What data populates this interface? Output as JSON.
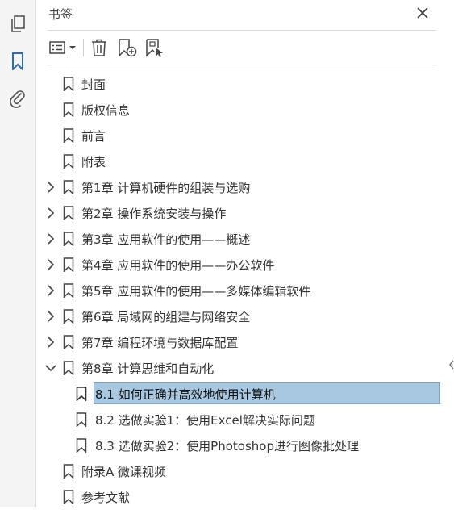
{
  "panel": {
    "title": "书签",
    "close_icon": "close-icon"
  },
  "rail": {
    "icons": [
      "pages-icon",
      "bookmark-icon",
      "attachment-icon"
    ],
    "active": "bookmark-icon",
    "active_color": "#2b6cb0"
  },
  "toolbar": {
    "icons": [
      "options-menu-icon",
      "delete-icon",
      "new-bookmark-icon",
      "bookmark-from-selection-icon"
    ]
  },
  "bookmarks": [
    {
      "label": "封面",
      "level": 0,
      "expandable": false
    },
    {
      "label": "版权信息",
      "level": 0,
      "expandable": false
    },
    {
      "label": "前言",
      "level": 0,
      "expandable": false
    },
    {
      "label": "附表",
      "level": 0,
      "expandable": false
    },
    {
      "label": "第1章 计算机硬件的组装与选购",
      "level": 0,
      "expandable": true,
      "expanded": false
    },
    {
      "label": "第2章 操作系统安装与操作",
      "level": 0,
      "expandable": true,
      "expanded": false
    },
    {
      "label": "第3章 应用软件的使用——概述",
      "level": 0,
      "expandable": true,
      "expanded": false,
      "underlined": true
    },
    {
      "label": "第4章 应用软件的使用——办公软件",
      "level": 0,
      "expandable": true,
      "expanded": false
    },
    {
      "label": "第5章 应用软件的使用——多媒体编辑软件",
      "level": 0,
      "expandable": true,
      "expanded": false
    },
    {
      "label": "第6章 局域网的组建与网络安全",
      "level": 0,
      "expandable": true,
      "expanded": false
    },
    {
      "label": "第7章 编程环境与数据库配置",
      "level": 0,
      "expandable": true,
      "expanded": false
    },
    {
      "label": "第8章 计算思维和自动化",
      "level": 0,
      "expandable": true,
      "expanded": true
    },
    {
      "label": "8.1 如何正确并高效地使用计算机",
      "level": 1,
      "expandable": false,
      "selected": true
    },
    {
      "label": "8.2 选做实验1：使用Excel解决实际问题",
      "level": 1,
      "expandable": false
    },
    {
      "label": "8.3 选做实验2：使用Photoshop进行图像批处理",
      "level": 1,
      "expandable": false
    },
    {
      "label": "附录A 微课视频",
      "level": 0,
      "expandable": false
    },
    {
      "label": "参考文献",
      "level": 0,
      "expandable": false
    }
  ],
  "colors": {
    "selection": "#a8c8e2",
    "icon": "#444444"
  }
}
